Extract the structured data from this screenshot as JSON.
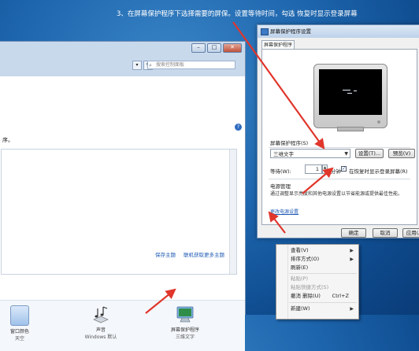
{
  "instruction": "3、在屏幕保护程序下选择需要的屏保。设置等待时间，勾选 恢复时显示登录屏幕",
  "personalization_window": {
    "search_placeholder": "搜索控制面板",
    "text_fragment": "序。",
    "links": {
      "save_theme": "保存主题",
      "online_themes": "联机获取更多主题"
    },
    "bottom_items": [
      {
        "label": "窗口颜色",
        "sub": "天空"
      },
      {
        "label": "声音",
        "sub": "Windows 默认"
      },
      {
        "label": "屏幕保护程序",
        "sub": "三维文字"
      }
    ]
  },
  "screensaver_dialog": {
    "title": "屏幕保护程序设置",
    "tab": "屏幕保护程序",
    "group_label": "屏幕保护程序(S)",
    "selected": "三维文字",
    "settings_button": "设置(T)...",
    "preview_button": "预览(V)",
    "wait_label": "等待(W):",
    "wait_value": "1",
    "wait_unit": "分钟",
    "resume_checked": true,
    "resume_label": "在恢复时显示登录屏幕(R)",
    "power_title": "电源管理",
    "power_desc": "通过调整显示亮度和其他电源设置以节省能源或提供最佳性能。",
    "power_link": "更改电源设置",
    "ok": "确定",
    "cancel": "取消",
    "apply": "应用(A)"
  },
  "context_menu": {
    "items": [
      {
        "label": "查看(V)",
        "has_submenu": true,
        "disabled": false
      },
      {
        "label": "排序方式(O)",
        "has_submenu": true,
        "disabled": false
      },
      {
        "label": "刷新(E)",
        "has_submenu": false,
        "disabled": false
      },
      {
        "label": "粘贴(P)",
        "has_submenu": false,
        "disabled": true
      },
      {
        "label": "粘贴快捷方式(S)",
        "has_submenu": false,
        "disabled": true
      },
      {
        "label": "撤消 删除(U)",
        "shortcut": "Ctrl+Z",
        "has_submenu": false,
        "disabled": false
      },
      {
        "label": "新建(W)",
        "has_submenu": true,
        "disabled": false
      }
    ]
  },
  "colors": {
    "arrow": "#e0362c",
    "link": "#1e5bb5",
    "desktop": "#1d65ad"
  }
}
